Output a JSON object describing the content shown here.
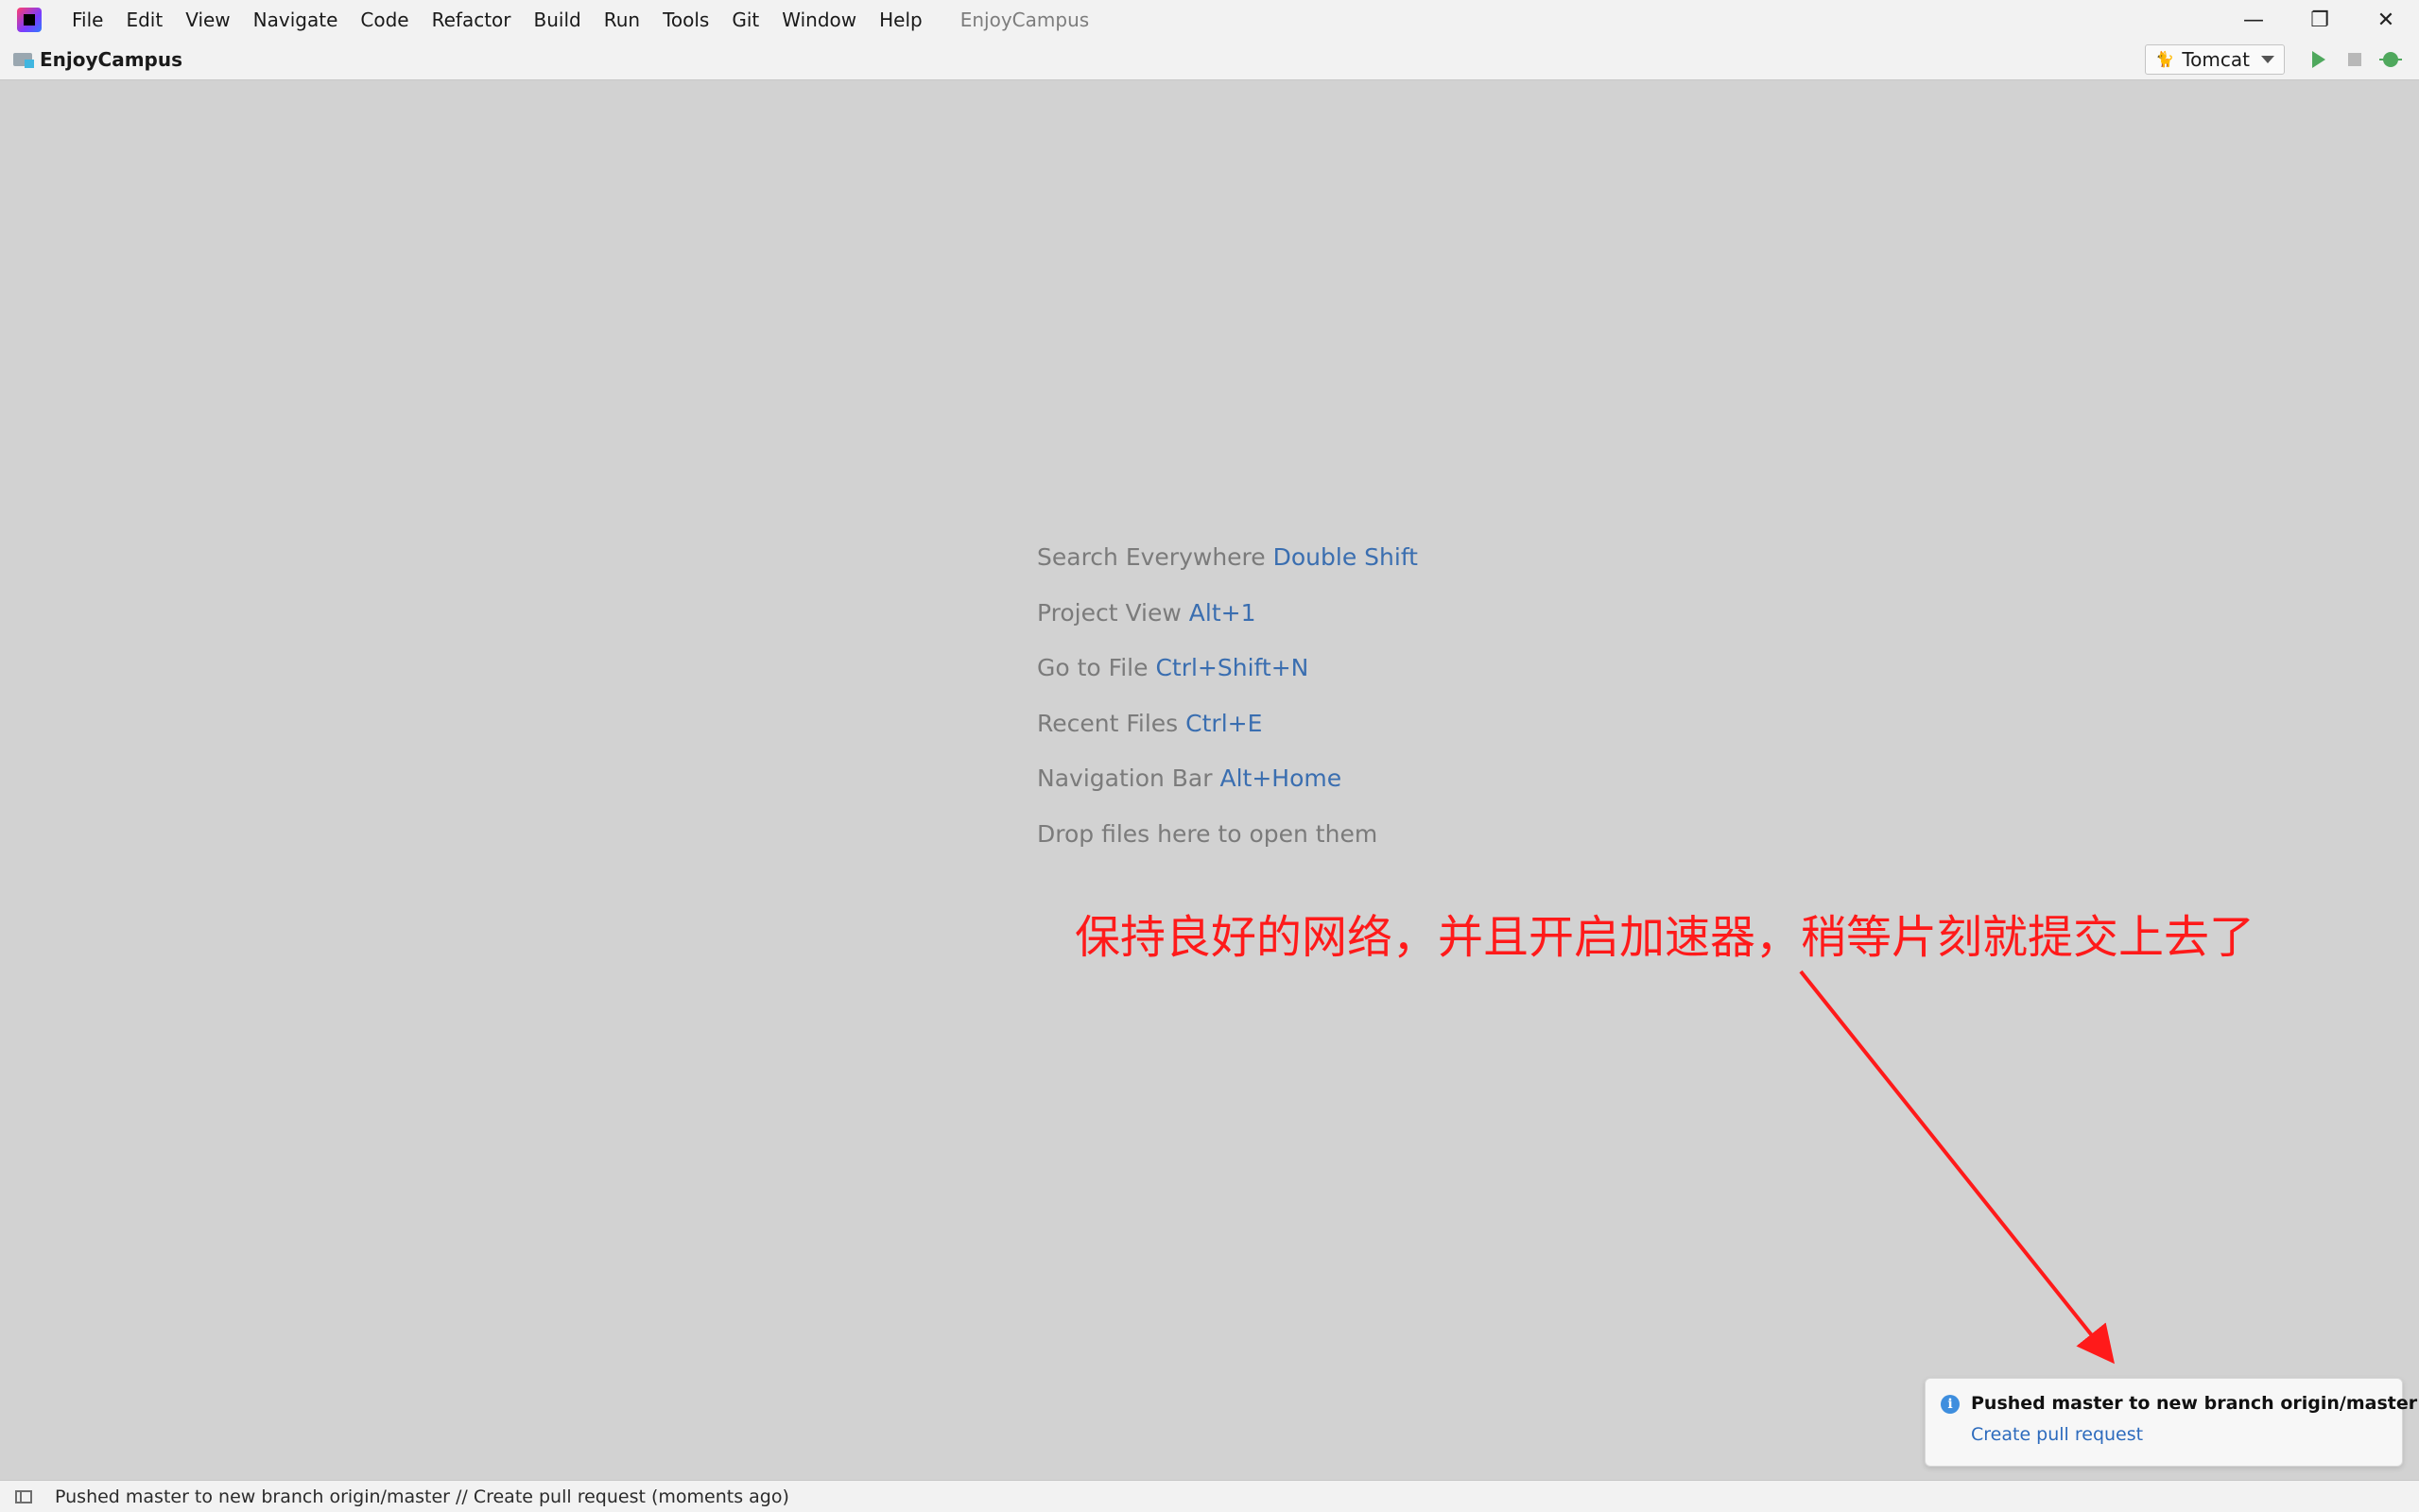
{
  "menubar": {
    "items": [
      "File",
      "Edit",
      "View",
      "Navigate",
      "Code",
      "Refactor",
      "Build",
      "Run",
      "Tools",
      "Git",
      "Window",
      "Help"
    ],
    "window_title": "EnjoyCampus",
    "controls": {
      "minimize": "—",
      "restore": "❐",
      "close": "✕"
    }
  },
  "navbar": {
    "project": "EnjoyCampus",
    "run_config": "Tomcat",
    "icons": [
      "folder-icon",
      "tomcat-icon",
      "run-icon",
      "stop-icon",
      "debug-icon"
    ]
  },
  "hints": [
    {
      "label": "Search Everywhere",
      "shortcut": "Double Shift"
    },
    {
      "label": "Project View",
      "shortcut": "Alt+1"
    },
    {
      "label": "Go to File",
      "shortcut": "Ctrl+Shift+N"
    },
    {
      "label": "Recent Files",
      "shortcut": "Ctrl+E"
    },
    {
      "label": "Navigation Bar",
      "shortcut": "Alt+Home"
    },
    {
      "label": "Drop files here to open them",
      "shortcut": ""
    }
  ],
  "annotation": {
    "text": "保持良好的网络，并且开启加速器，稍等片刻就提交上去了",
    "color": "#ff1a1a"
  },
  "notification": {
    "title": "Pushed master to new branch origin/master",
    "link": "Create pull request",
    "icon": "info-icon"
  },
  "statusbar": {
    "text": "Pushed master to new branch origin/master // Create pull request (moments ago)"
  },
  "colors": {
    "background": "#d2d2d2",
    "shortcut": "#3a6eb0",
    "accent_link": "#2d6bbd"
  }
}
